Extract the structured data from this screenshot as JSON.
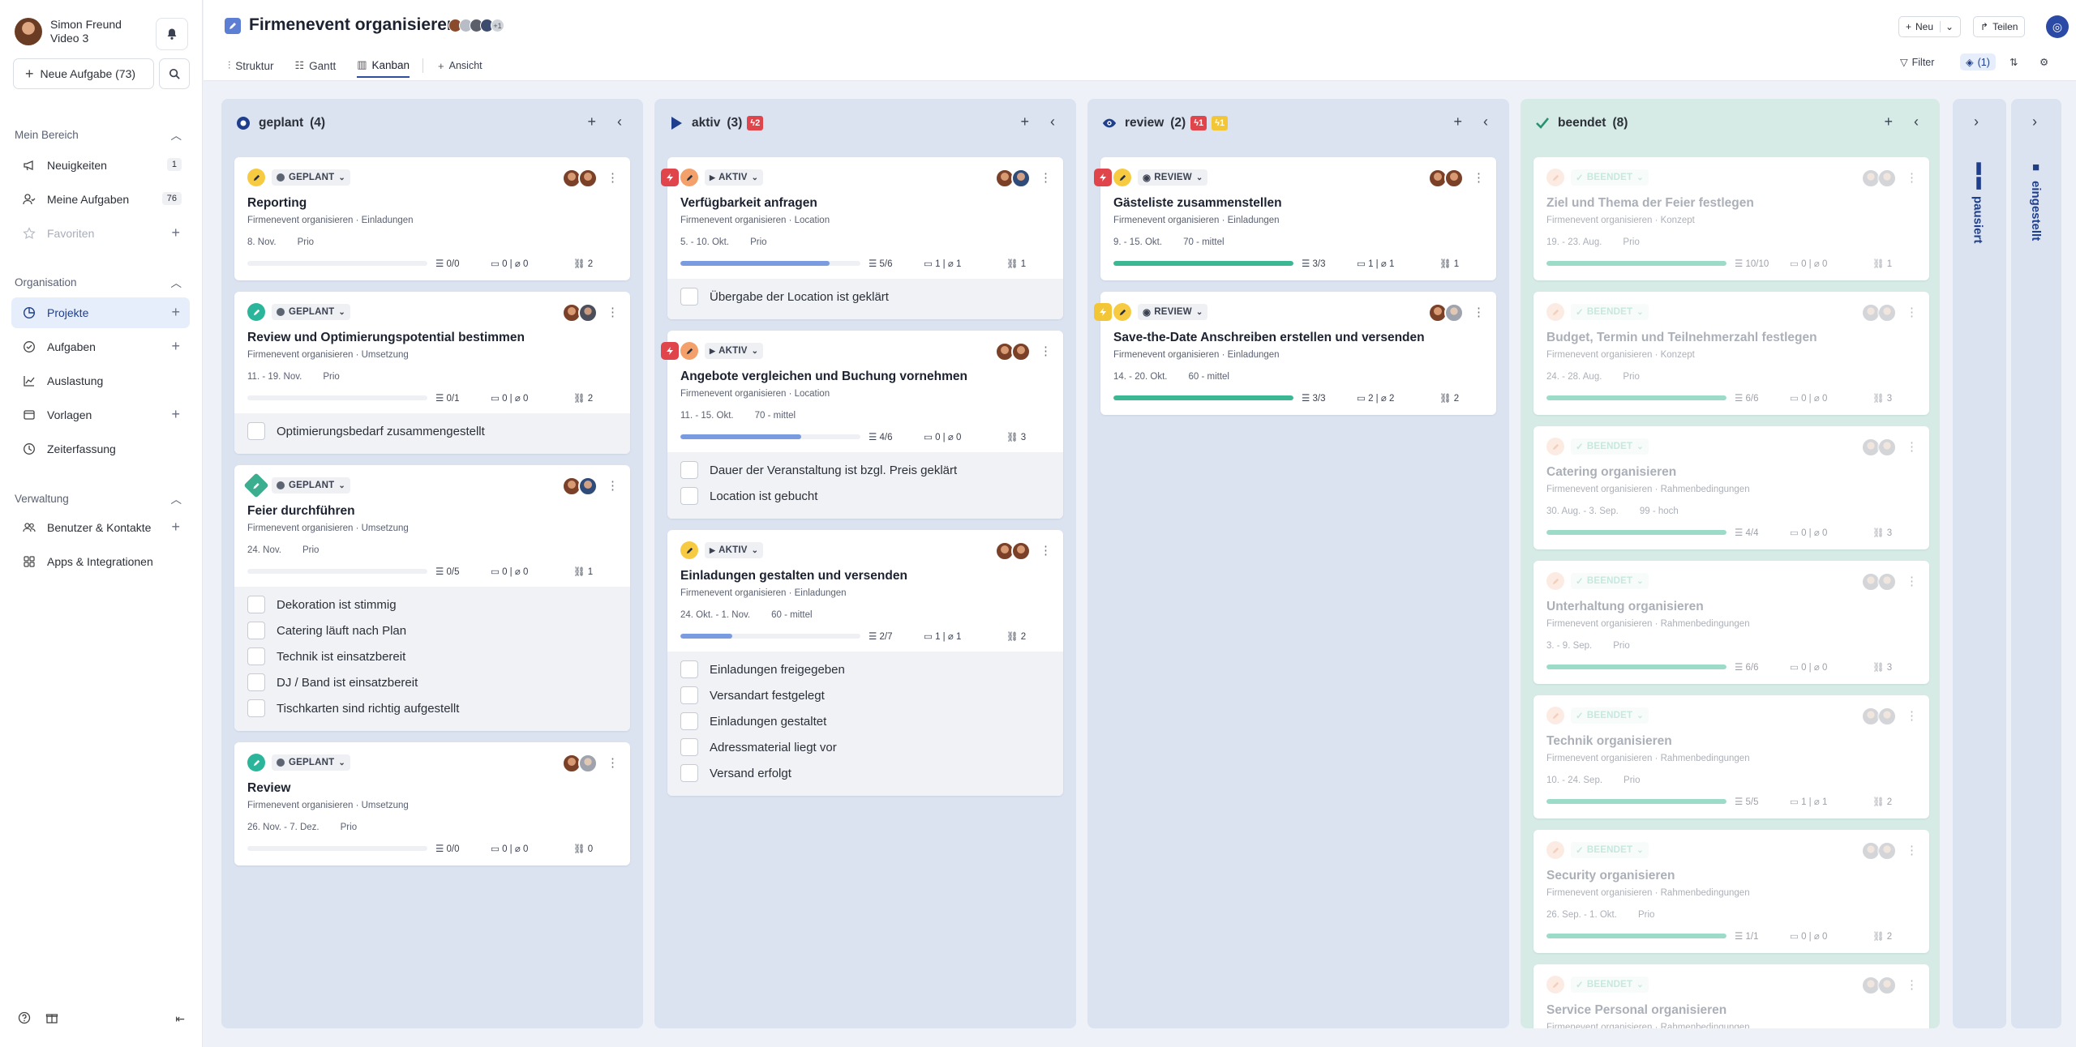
{
  "user": {
    "name": "Simon Freund",
    "subtitle": "Video 3",
    "notifications": ""
  },
  "sidebar": {
    "new_task": "Neue Aufgabe (73)",
    "sections": [
      {
        "title": "Mein Bereich",
        "items": [
          {
            "label": "Neuigkeiten",
            "badge": "1"
          },
          {
            "label": "Meine Aufgaben",
            "badge": "76"
          },
          {
            "label": "Favoriten",
            "badge": ""
          }
        ]
      },
      {
        "title": "Organisation",
        "items": [
          {
            "label": "Projekte"
          },
          {
            "label": "Aufgaben"
          },
          {
            "label": "Auslastung"
          },
          {
            "label": "Vorlagen"
          },
          {
            "label": "Zeiterfassung"
          }
        ]
      },
      {
        "title": "Verwaltung",
        "items": [
          {
            "label": "Benutzer & Kontakte"
          },
          {
            "label": "Apps & Integrationen"
          }
        ]
      }
    ]
  },
  "header": {
    "title": "Firmenevent organisieren",
    "members_extra": "+1",
    "tabs": [
      "Struktur",
      "Gantt",
      "Kanban",
      "Ansicht"
    ],
    "active_tab": "Kanban",
    "buttons": {
      "new": "Neu",
      "share": "Teilen"
    },
    "tools": {
      "filter": "Filter",
      "layers": "(1)"
    }
  },
  "columns": [
    {
      "name": "geplant",
      "count": "(4)",
      "badges": [],
      "cards": [
        {
          "status": "GEPLANT",
          "title": "Reporting",
          "path": "Firmenevent organisieren · Einladungen",
          "date": "8. Nov.",
          "prio": "Prio",
          "progress": 0,
          "subtasks": "0/0",
          "comments": "0",
          "attachments": "0",
          "links": "2",
          "checklist": []
        },
        {
          "status": "GEPLANT",
          "title": "Review und Optimierungspotential bestimmen",
          "path": "Firmenevent organisieren · Umsetzung",
          "date": "11. - 19. Nov.",
          "prio": "Prio",
          "progress": 0,
          "subtasks": "0/1",
          "comments": "0",
          "attachments": "0",
          "links": "2",
          "checklist": [
            "Optimierungsbedarf zusammengestellt"
          ]
        },
        {
          "status": "GEPLANT",
          "title": "Feier durchführen",
          "path": "Firmenevent organisieren · Umsetzung",
          "date": "24. Nov.",
          "prio": "Prio",
          "progress": 0,
          "subtasks": "0/5",
          "comments": "0",
          "attachments": "0",
          "links": "1",
          "checklist": [
            "Dekoration ist stimmig",
            "Catering läuft nach Plan",
            "Technik ist einsatzbereit",
            "DJ / Band ist einsatzbereit",
            "Tischkarten sind richtig aufgestellt"
          ]
        },
        {
          "status": "GEPLANT",
          "title": "Review",
          "path": "Firmenevent organisieren · Umsetzung",
          "date": "26. Nov. - 7. Dez.",
          "prio": "Prio",
          "progress": 0,
          "subtasks": "0/0",
          "comments": "0",
          "attachments": "0",
          "links": "0",
          "checklist": []
        }
      ]
    },
    {
      "name": "aktiv",
      "count": "(3)",
      "badges": [
        {
          "type": "red",
          "text": "2"
        }
      ],
      "cards": [
        {
          "status": "AKTIV",
          "title": "Verfügbarkeit anfragen",
          "path": "Firmenevent organisieren · Location",
          "date": "5. - 10. Okt.",
          "prio": "Prio",
          "progress": 0.83,
          "subtasks": "5/6",
          "comments": "1",
          "attachments": "1",
          "links": "1",
          "checklist": [
            "Übergabe der Location ist geklärt"
          ]
        },
        {
          "status": "AKTIV",
          "title": "Angebote vergleichen und Buchung vornehmen",
          "path": "Firmenevent organisieren · Location",
          "date": "11. - 15. Okt.",
          "prio": "70 - mittel",
          "progress": 0.67,
          "subtasks": "4/6",
          "comments": "0",
          "attachments": "0",
          "links": "3",
          "checklist": [
            "Dauer der Veranstaltung ist bzgl. Preis geklärt",
            "Location ist gebucht"
          ]
        },
        {
          "status": "AKTIV",
          "title": "Einladungen gestalten und versenden",
          "path": "Firmenevent organisieren · Einladungen",
          "date": "24. Okt. - 1. Nov.",
          "prio": "60 - mittel",
          "progress": 0.29,
          "subtasks": "2/7",
          "comments": "1",
          "attachments": "1",
          "links": "2",
          "checklist": [
            "Einladungen freigegeben",
            "Versandart festgelegt",
            "Einladungen gestaltet",
            "Adressmaterial liegt vor",
            "Versand erfolgt"
          ]
        }
      ]
    },
    {
      "name": "review",
      "count": "(2)",
      "badges": [
        {
          "type": "red",
          "text": "1"
        },
        {
          "type": "yel",
          "text": "1"
        }
      ],
      "cards": [
        {
          "status": "REVIEW",
          "title": "Gästeliste zusammenstellen",
          "path": "Firmenevent organisieren · Einladungen",
          "date": "9. - 15. Okt.",
          "prio": "70 - mittel",
          "progress": 1,
          "subtasks": "3/3",
          "comments": "1",
          "attachments": "1",
          "links": "1",
          "checklist": []
        },
        {
          "status": "REVIEW",
          "title": "Save-the-Date Anschreiben erstellen und versenden",
          "path": "Firmenevent organisieren · Einladungen",
          "date": "14. - 20. Okt.",
          "prio": "60 - mittel",
          "progress": 1,
          "subtasks": "3/3",
          "comments": "2",
          "attachments": "2",
          "links": "2",
          "checklist": []
        }
      ]
    },
    {
      "name": "beendet",
      "count": "(8)",
      "badges": [],
      "cards": [
        {
          "status": "BEENDET",
          "title": "Ziel und Thema der Feier festlegen",
          "path": "Firmenevent organisieren · Konzept",
          "date": "19. - 23. Aug.",
          "prio": "Prio",
          "progress": 1,
          "subtasks": "10/10",
          "comments": "0",
          "attachments": "0",
          "links": "1"
        },
        {
          "status": "BEENDET",
          "title": "Budget, Termin und Teilnehmerzahl festlegen",
          "path": "Firmenevent organisieren · Konzept",
          "date": "24. - 28. Aug.",
          "prio": "Prio",
          "progress": 1,
          "subtasks": "6/6",
          "comments": "0",
          "attachments": "0",
          "links": "3"
        },
        {
          "status": "BEENDET",
          "title": "Catering organisieren",
          "path": "Firmenevent organisieren · Rahmenbedingungen",
          "date": "30. Aug. - 3. Sep.",
          "prio": "99 - hoch",
          "progress": 1,
          "subtasks": "4/4",
          "comments": "0",
          "attachments": "0",
          "links": "3"
        },
        {
          "status": "BEENDET",
          "title": "Unterhaltung organisieren",
          "path": "Firmenevent organisieren · Rahmenbedingungen",
          "date": "3. - 9. Sep.",
          "prio": "Prio",
          "progress": 1,
          "subtasks": "6/6",
          "comments": "0",
          "attachments": "0",
          "links": "3"
        },
        {
          "status": "BEENDET",
          "title": "Technik organisieren",
          "path": "Firmenevent organisieren · Rahmenbedingungen",
          "date": "10. - 24. Sep.",
          "prio": "Prio",
          "progress": 1,
          "subtasks": "5/5",
          "comments": "1",
          "attachments": "1",
          "links": "2"
        },
        {
          "status": "BEENDET",
          "title": "Security organisieren",
          "path": "Firmenevent organisieren · Rahmenbedingungen",
          "date": "26. Sep. - 1. Okt.",
          "prio": "Prio",
          "progress": 1,
          "subtasks": "1/1",
          "comments": "0",
          "attachments": "0",
          "links": "2"
        },
        {
          "status": "BEENDET",
          "title": "Service Personal organisieren",
          "path": "Firmenevent organisieren · Rahmenbedingungen",
          "date": "",
          "prio": "",
          "progress": 1,
          "subtasks": "",
          "comments": "",
          "attachments": "",
          "links": ""
        }
      ]
    }
  ],
  "collapsed_columns": [
    {
      "name": "pausiert"
    },
    {
      "name": "eingestellt"
    }
  ],
  "colors": {
    "accent": "#2f4e9e",
    "progress_blue": "#7b9be0",
    "progress_green": "#3bb893",
    "urgent": "#e0454c",
    "warning": "#f3c637"
  }
}
